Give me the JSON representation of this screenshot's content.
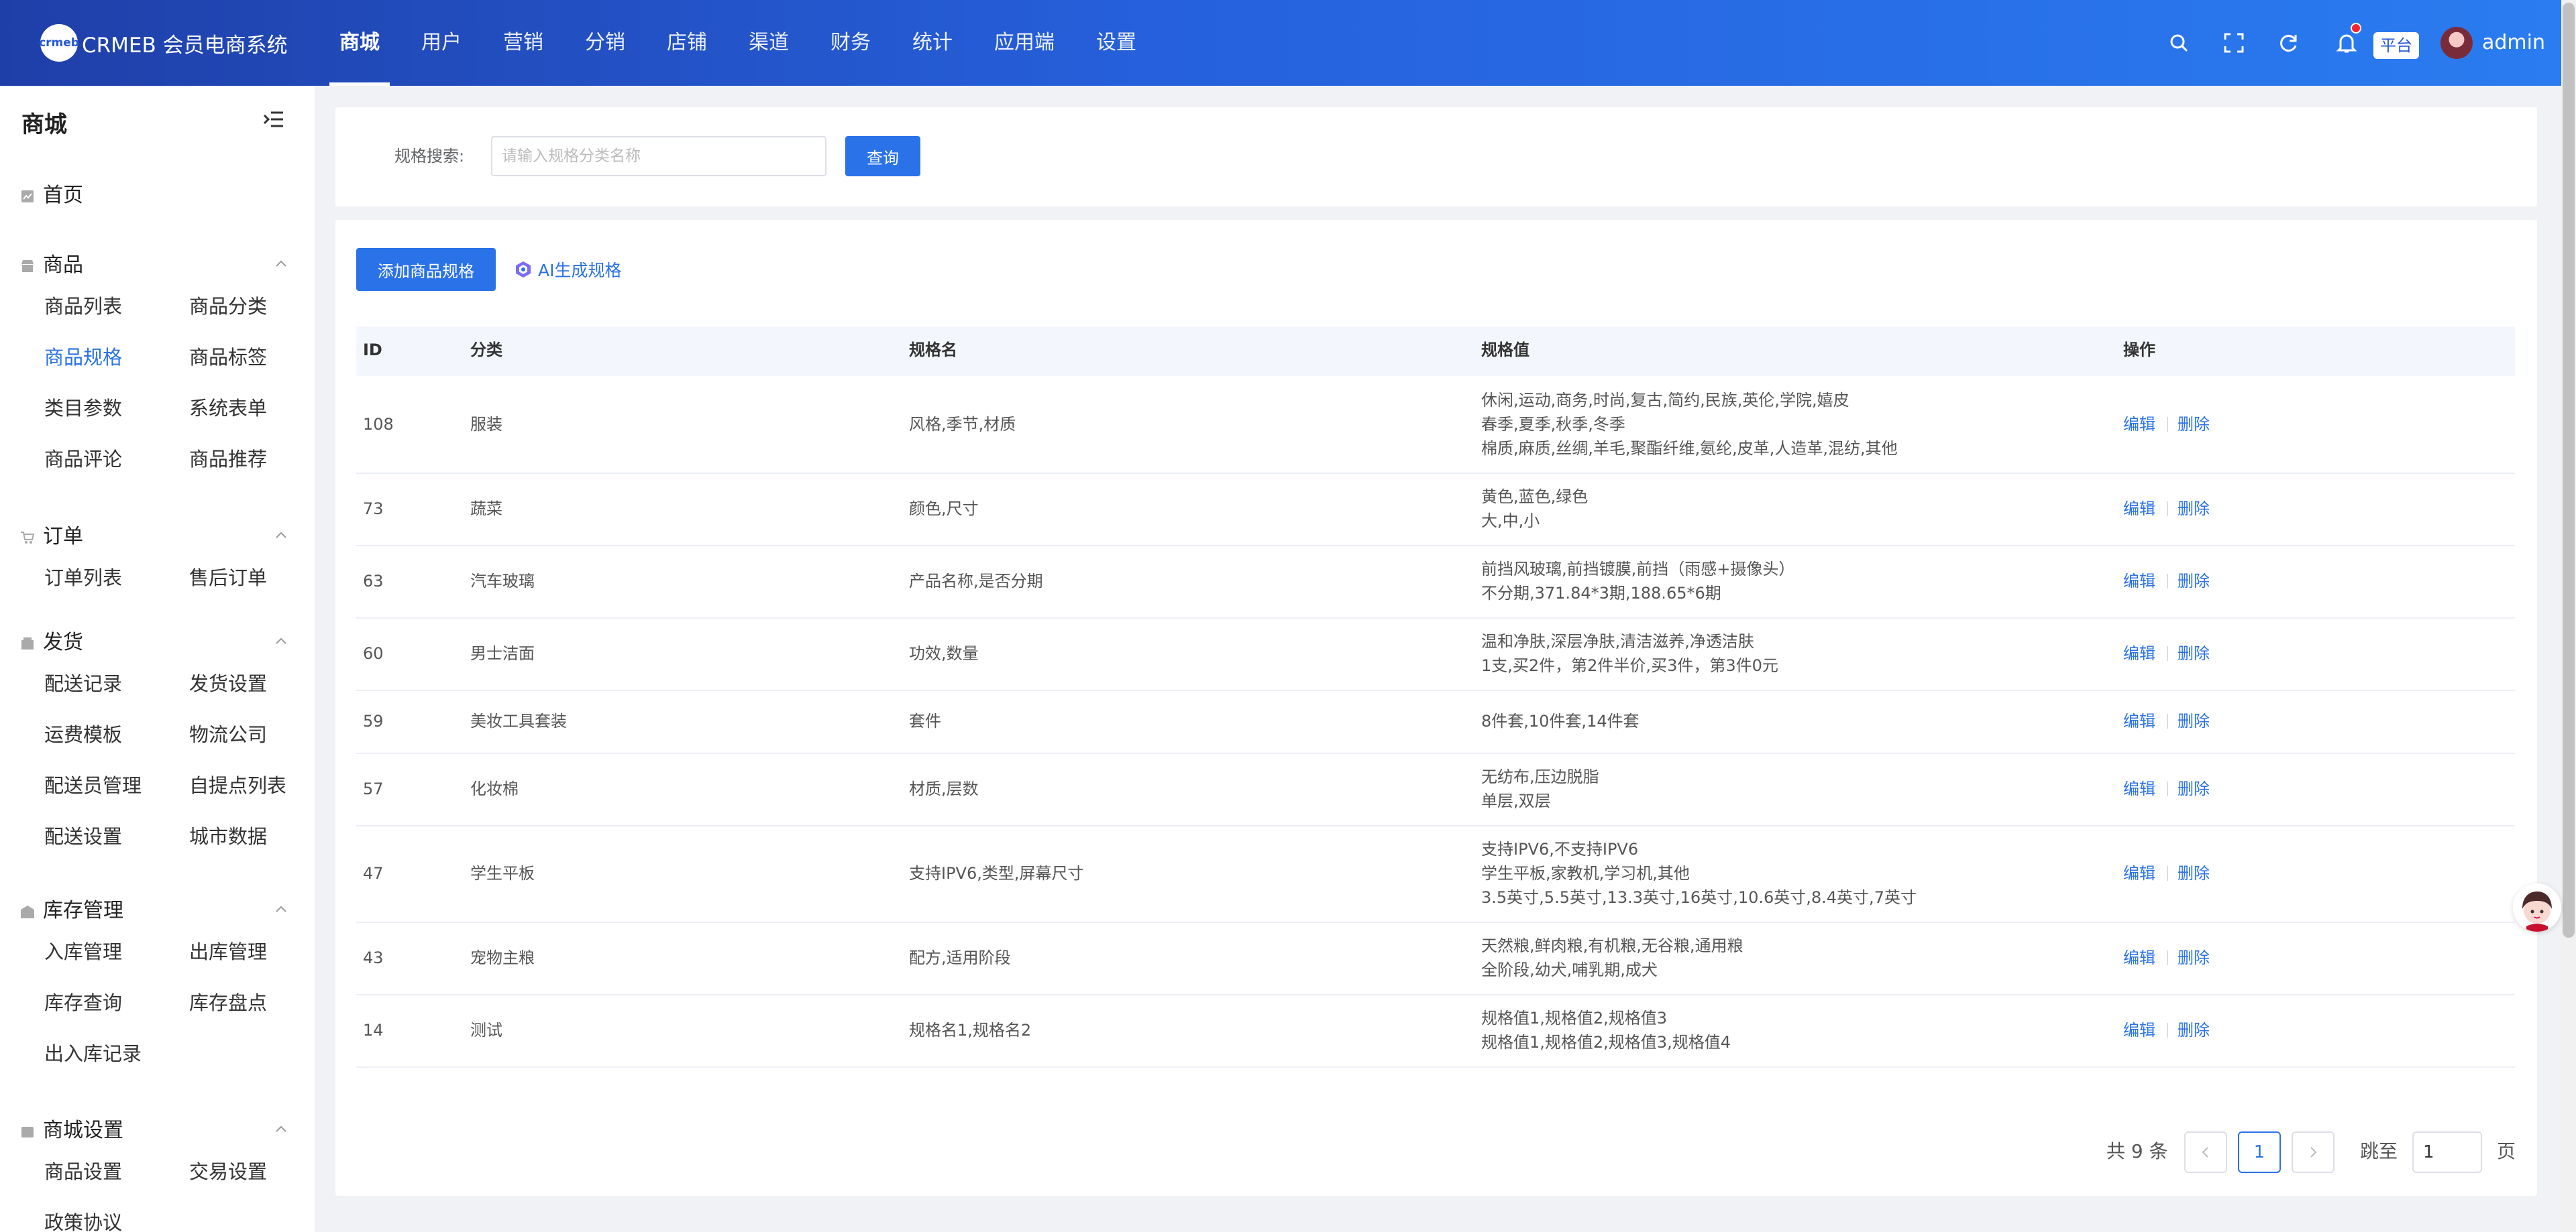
{
  "header": {
    "logo_badge": "crmeb",
    "logo_text": "CRMEB 会员电商系统",
    "nav": [
      "商城",
      "用户",
      "营销",
      "分销",
      "店铺",
      "渠道",
      "财务",
      "统计",
      "应用端",
      "设置"
    ],
    "active_nav": "商城",
    "platform_tag": "平台",
    "user_name": "admin",
    "icons": [
      "search-icon",
      "fullscreen-icon",
      "refresh-icon",
      "bell-icon"
    ],
    "colors": {
      "gradient_start": "#1f3fa8",
      "gradient_end": "#2a7cf0"
    }
  },
  "sidebar": {
    "title": "商城",
    "home": "首页",
    "groups": [
      {
        "label": "商品",
        "icon": "shop-icon",
        "items": [
          "商品列表",
          "商品分类",
          "商品规格",
          "商品标签",
          "类目参数",
          "系统表单",
          "商品评论",
          "商品推荐"
        ]
      },
      {
        "label": "订单",
        "icon": "cart-icon",
        "items": [
          "订单列表",
          "售后订单"
        ]
      },
      {
        "label": "发货",
        "icon": "box-icon",
        "items": [
          "配送记录",
          "发货设置",
          "运费模板",
          "物流公司",
          "配送员管理",
          "自提点列表",
          "配送设置",
          "城市数据"
        ]
      },
      {
        "label": "库存管理",
        "icon": "warehouse-icon",
        "items": [
          "入库管理",
          "出库管理",
          "库存查询",
          "库存盘点",
          "出入库记录"
        ]
      },
      {
        "label": "商城设置",
        "icon": "store-settings-icon",
        "items": [
          "商品设置",
          "交易设置",
          "政策协议"
        ]
      }
    ],
    "active_item": "商品规格"
  },
  "search": {
    "label": "规格搜索:",
    "placeholder": "请输入规格分类名称",
    "value": "",
    "button": "查询"
  },
  "toolbar": {
    "add_button": "添加商品规格",
    "ai_button": "AI生成规格"
  },
  "table": {
    "columns": [
      "ID",
      "分类",
      "规格名",
      "规格值",
      "操作"
    ],
    "rows": [
      {
        "id": "108",
        "category": "服装",
        "spec_name": "风格,季节,材质",
        "spec_values": [
          "休闲,运动,商务,时尚,复古,简约,民族,英伦,学院,嬉皮",
          "春季,夏季,秋季,冬季",
          "棉质,麻质,丝绸,羊毛,聚酯纤维,氨纶,皮革,人造革,混纺,其他"
        ]
      },
      {
        "id": "73",
        "category": "蔬菜",
        "spec_name": "颜色,尺寸",
        "spec_values": [
          "黄色,蓝色,绿色",
          "大,中,小"
        ]
      },
      {
        "id": "63",
        "category": "汽车玻璃",
        "spec_name": "产品名称,是否分期",
        "spec_values": [
          "前挡风玻璃,前挡镀膜,前挡（雨感+摄像头）",
          "不分期,371.84*3期,188.65*6期"
        ]
      },
      {
        "id": "60",
        "category": "男士洁面",
        "spec_name": "功效,数量",
        "spec_values": [
          "温和净肤,深层净肤,清洁滋养,净透洁肤",
          "1支,买2件，第2件半价,买3件，第3件0元"
        ]
      },
      {
        "id": "59",
        "category": "美妆工具套装",
        "spec_name": "套件",
        "spec_values": [
          "8件套,10件套,14件套"
        ]
      },
      {
        "id": "57",
        "category": "化妆棉",
        "spec_name": "材质,层数",
        "spec_values": [
          "无纺布,压边脱脂",
          "单层,双层"
        ]
      },
      {
        "id": "47",
        "category": "学生平板",
        "spec_name": "支持IPV6,类型,屏幕尺寸",
        "spec_values": [
          "支持IPV6,不支持IPV6",
          "学生平板,家教机,学习机,其他",
          "3.5英寸,5.5英寸,13.3英寸,16英寸,10.6英寸,8.4英寸,7英寸"
        ]
      },
      {
        "id": "43",
        "category": "宠物主粮",
        "spec_name": "配方,适用阶段",
        "spec_values": [
          "天然粮,鲜肉粮,有机粮,无谷粮,通用粮",
          "全阶段,幼犬,哺乳期,成犬"
        ]
      },
      {
        "id": "14",
        "category": "测试",
        "spec_name": "规格名1,规格名2",
        "spec_values": [
          "规格值1,规格值2,规格值3",
          "规格值1,规格值2,规格值3,规格值4"
        ]
      }
    ],
    "edit_label": "编辑",
    "delete_label": "删除"
  },
  "pagination": {
    "total_text": "共 9 条",
    "current_page": "1",
    "jump_label": "跳至",
    "jump_value": "1",
    "page_suffix": "页"
  },
  "watermark_text": "crmeb"
}
